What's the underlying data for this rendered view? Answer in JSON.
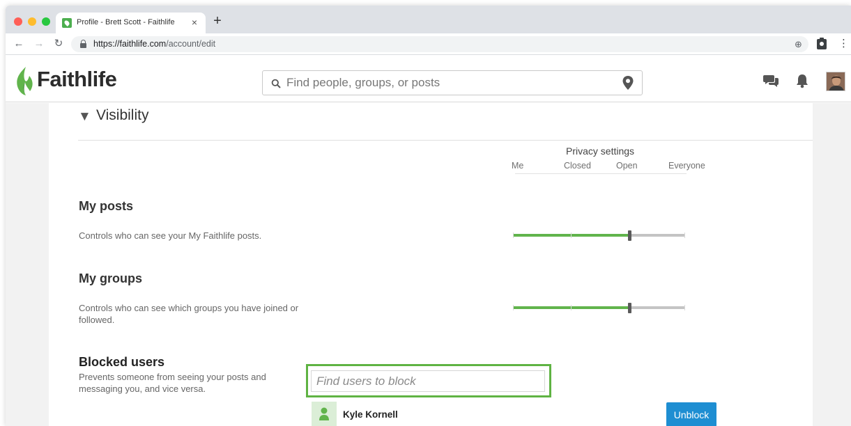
{
  "browser": {
    "tab_title": "Profile - Brett Scott - Faithlife",
    "tab_close": "×",
    "new_tab": "+",
    "url_host": "https://faithlife.com",
    "url_path": "/account/edit"
  },
  "site": {
    "logo_text": "Faithlife",
    "brand_color": "#61b44c",
    "search_placeholder": "Find people, groups, or posts"
  },
  "visibility": {
    "toggle_glyph": "▼",
    "title": "Visibility",
    "privacy_title": "Privacy settings",
    "levels": [
      "Me",
      "Closed",
      "Open",
      "Everyone"
    ]
  },
  "settings": [
    {
      "title": "My posts",
      "description": "Controls who can see your My Faithlife posts.",
      "selected_level": "Open"
    },
    {
      "title": "My groups",
      "description": "Controls who can see which groups you have joined or followed.",
      "selected_level": "Open"
    }
  ],
  "blocked": {
    "title": "Blocked users",
    "description": "Prevents someone from seeing your posts and messaging you, and vice versa.",
    "input_placeholder": "Find users to block",
    "highlight_color": "#5fb343",
    "users": [
      {
        "name": "Kyle Kornell",
        "action_label": "Unblock"
      }
    ]
  }
}
